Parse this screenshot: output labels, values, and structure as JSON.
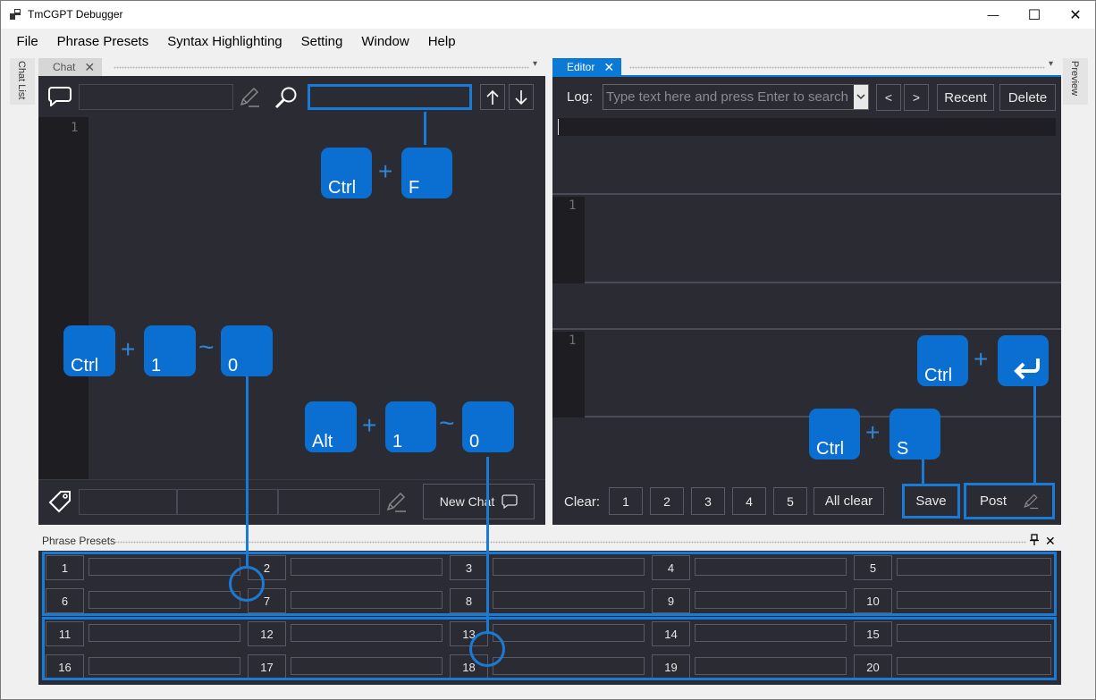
{
  "window": {
    "title": "TmCGPT Debugger",
    "minimize": "—",
    "maximize": "☐",
    "close": "✕"
  },
  "menu": [
    "File",
    "Phrase Presets",
    "Syntax Highlighting",
    "Setting",
    "Window",
    "Help"
  ],
  "side_tabs": {
    "left": "Chat List",
    "right": "Preview"
  },
  "chat": {
    "tab_label": "Chat",
    "tab_close": "✕",
    "line_number": "1",
    "new_chat_label": "New Chat"
  },
  "editor": {
    "tab_label": "Editor",
    "tab_close": "✕",
    "log_label": "Log:",
    "search_placeholder": "Type text here and press Enter to search",
    "prev_label": "<",
    "next_label": ">",
    "recent_label": "Recent",
    "delete_label": "Delete",
    "line_number_a": "1",
    "line_number_b": "1",
    "clear_label": "Clear:",
    "clear_buttons": [
      "1",
      "2",
      "3",
      "4",
      "5"
    ],
    "all_clear_label": "All clear",
    "save_label": "Save",
    "post_label": "Post"
  },
  "shortcuts": {
    "ctrl": "Ctrl",
    "alt": "Alt",
    "f": "F",
    "s": "S",
    "one": "1",
    "zero": "0",
    "plus": "+",
    "tilde": "~"
  },
  "phrase_presets": {
    "title": "Phrase Presets",
    "pin": "📌",
    "close": "✕",
    "slots": [
      "1",
      "2",
      "3",
      "4",
      "5",
      "6",
      "7",
      "8",
      "9",
      "10",
      "11",
      "12",
      "13",
      "14",
      "15",
      "16",
      "17",
      "18",
      "19",
      "20"
    ]
  },
  "colors": {
    "accent": "#0a6fd0",
    "panel": "#2b2b33",
    "gutter": "#1d1d22"
  }
}
